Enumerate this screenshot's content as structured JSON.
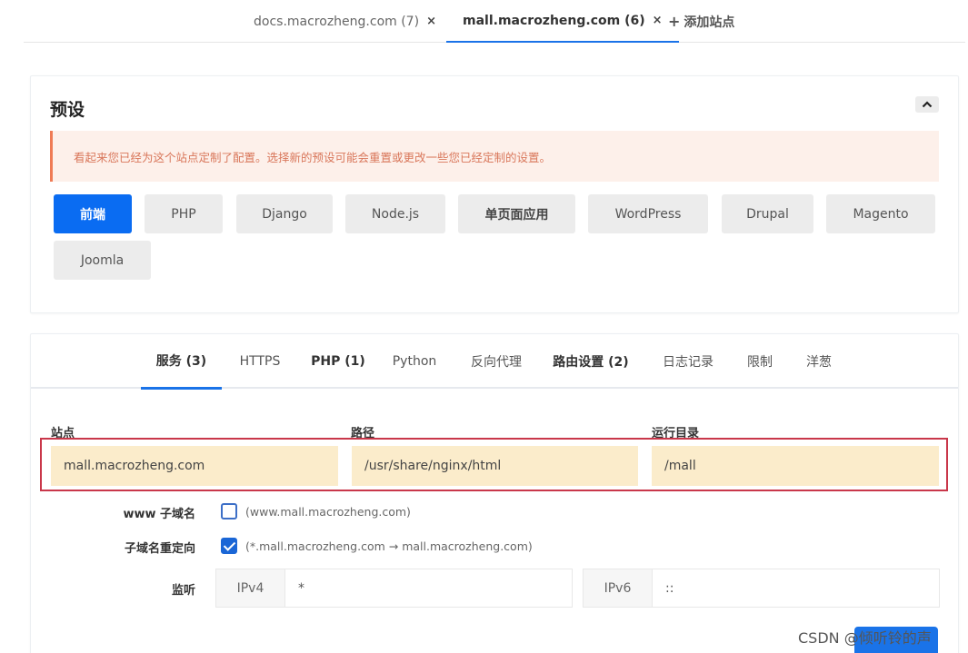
{
  "site_tabs": [
    {
      "label": "docs.macrozheng.com (7)",
      "close": "×"
    },
    {
      "label": "mall.macrozheng.com (6)",
      "close": "×"
    }
  ],
  "add_site": {
    "icon": "+",
    "label": "添加站点"
  },
  "preset": {
    "title": "预设",
    "warning": "看起来您已经为这个站点定制了配置。选择新的预设可能会重置或更改一些您已经定制的设置。",
    "buttons": [
      "前端",
      "PHP",
      "Django",
      "Node.js",
      "单页面应用",
      "WordPress",
      "Drupal",
      "Magento",
      "Joomla"
    ],
    "active": "前端"
  },
  "config_tabs": [
    "服务 (3)",
    "HTTPS",
    "PHP (1)",
    "Python",
    "反向代理",
    "路由设置 (2)",
    "日志记录",
    "限制",
    "洋葱"
  ],
  "active_config_tab": "服务 (3)",
  "fields": {
    "site_label": "站点",
    "site_value": "mall.macrozheng.com",
    "path_label": "路径",
    "path_value": "/usr/share/nginx/html",
    "root_label": "运行目录",
    "root_value": "/mall"
  },
  "www_subdomain": {
    "label": "www 子域名",
    "checked": false,
    "hint": "(www.mall.macrozheng.com)"
  },
  "subdomain_redirect": {
    "label": "子域名重定向",
    "checked": true,
    "hint": "(*.mall.macrozheng.com → mall.macrozheng.com)"
  },
  "listen": {
    "label": "监听",
    "ipv4_label": "IPv4",
    "ipv4_value": "*",
    "ipv6_label": "IPv6",
    "ipv6_value": "::"
  },
  "watermark": "CSDN @倾听铃的声",
  "colors": {
    "primary": "#0a6cf2",
    "warning_bg": "#fdf0ea",
    "warning_accent": "#ef7b55",
    "highlight_border": "#c9374a",
    "field_bg": "#fbeccb"
  }
}
